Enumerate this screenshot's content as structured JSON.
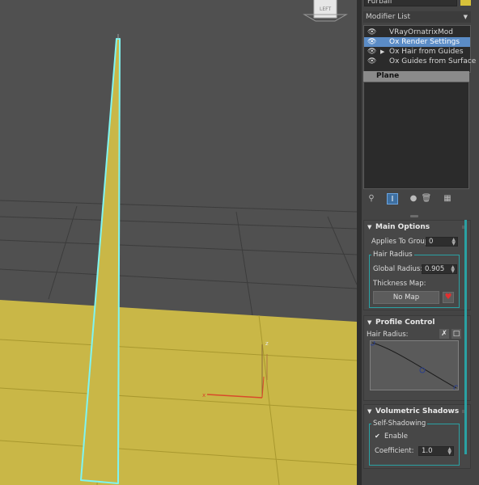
{
  "panel": {
    "object_name": "Furball",
    "modifier_list": {
      "label": "Modifier List",
      "arrow_icon": "dropdown-arrow-icon"
    },
    "stack": [
      {
        "label": "VRayOrnatrixMod",
        "selected": false,
        "expandable": false
      },
      {
        "label": "Ox Render Settings",
        "selected": true,
        "expandable": false
      },
      {
        "label": "Ox Hair from Guides",
        "selected": false,
        "expandable": true
      },
      {
        "label": "Ox Guides from Surface",
        "selected": false,
        "expandable": false
      }
    ],
    "base_object": "Plane",
    "accent_color": "#2aa1a3",
    "selection_color": "#5b8cc6",
    "swatch_color": "#d8c23a"
  },
  "main_options": {
    "title": "Main Options",
    "applies_label": "Applies To Group:",
    "applies_value": "0",
    "hair_radius_group": "Hair Radius",
    "global_radius_label": "Global Radius:",
    "global_radius_value": "0.905",
    "thickness_map_label": "Thickness Map:",
    "no_map_label": "No Map"
  },
  "profile_control": {
    "title": "Profile Control",
    "hair_radius_label": "Hair Radius:"
  },
  "volumetric_shadows": {
    "title": "Volumetric Shadows",
    "self_shadowing_group": "Self-Shadowing",
    "enable_label": "Enable",
    "enable_checked": true,
    "coefficient_label": "Coefficient:",
    "coefficient_value": "1.0"
  },
  "viewport": {
    "gizmo_label": "LEFT",
    "axis_x": "x",
    "axis_z": "z",
    "plane_color": "#c9b747",
    "hair_highlight": "#7ff5f2"
  }
}
